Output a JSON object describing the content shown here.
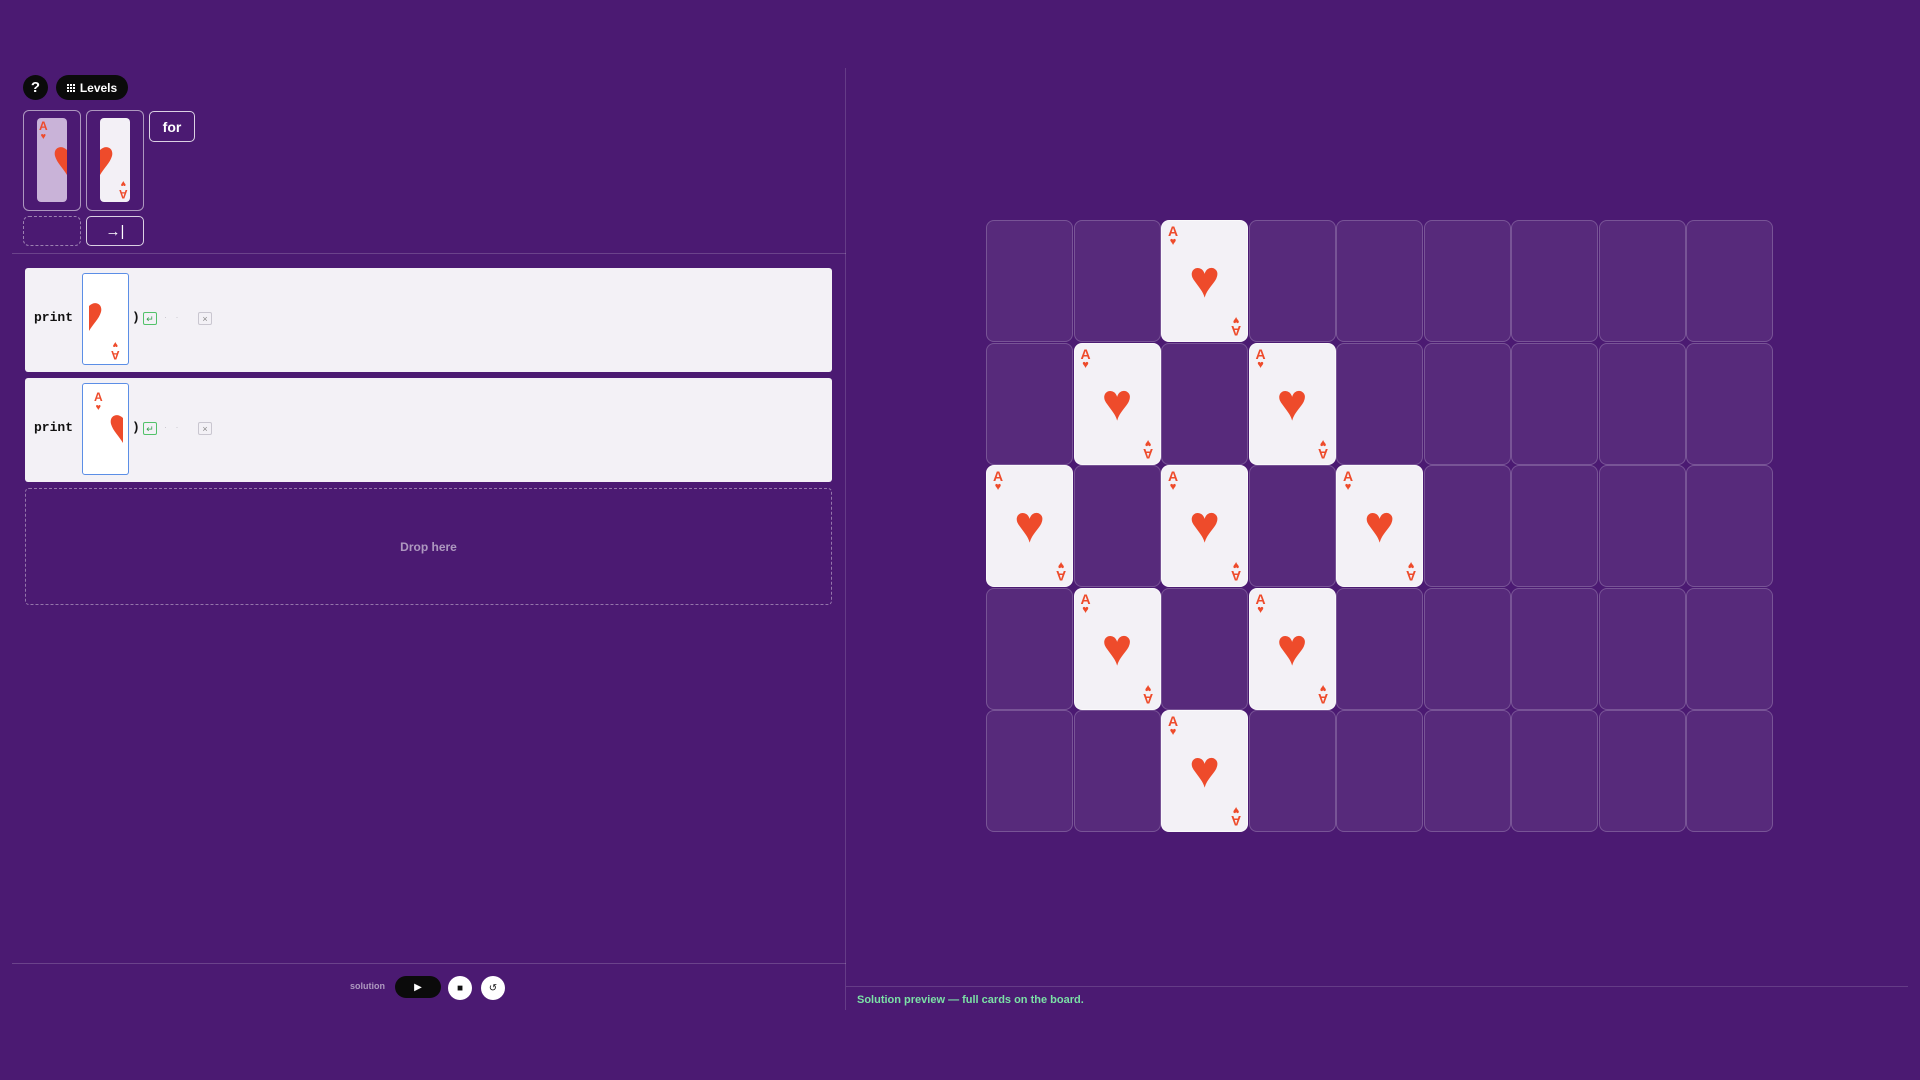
{
  "toolbar": {
    "help_label": "?",
    "levels_label": "Levels"
  },
  "palette": {
    "card_rank": "A",
    "suit_glyph": "♥",
    "for_label": "for",
    "indent_label": "→|"
  },
  "program": {
    "lines": [
      {
        "keyword": "print",
        "open": "(",
        "close": ")",
        "arg": "right-half-card",
        "newline_glyph": "↵",
        "dots": "· ·",
        "delete_glyph": "×"
      },
      {
        "keyword": "print",
        "open": "(",
        "close": ")",
        "arg": "left-half-card",
        "newline_glyph": "↵",
        "dots": "· ·",
        "delete_glyph": "×"
      }
    ],
    "drop_label": "Drop here"
  },
  "controls": {
    "solution_label": "solution",
    "play_glyph": "▶",
    "stop_glyph": "■",
    "reset_glyph": "↺"
  },
  "status": {
    "message": "Solution preview — full cards on the board."
  },
  "board": {
    "columns": 9,
    "rows": 5,
    "card_rank": "A",
    "suit_glyph": "♥",
    "suit_color": "#ee4b2b",
    "filled_cells": [
      [
        0,
        2
      ],
      [
        1,
        1
      ],
      [
        1,
        3
      ],
      [
        2,
        0
      ],
      [
        2,
        2
      ],
      [
        2,
        4
      ],
      [
        3,
        1
      ],
      [
        3,
        3
      ],
      [
        4,
        2
      ]
    ]
  },
  "colors": {
    "background": "#4b1a72",
    "card_face": "#f3f1f6",
    "accent_selected": "#5b8ee6",
    "status_text": "#7be0a6"
  }
}
